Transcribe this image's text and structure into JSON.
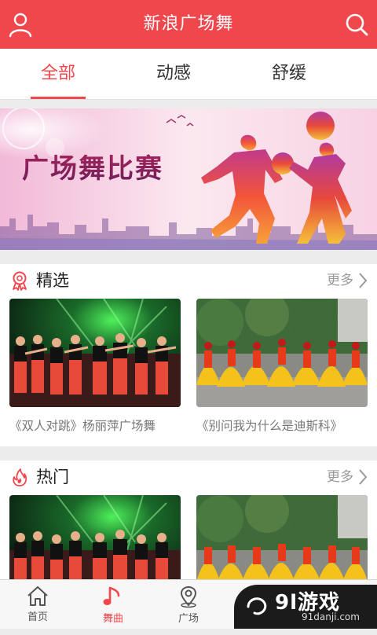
{
  "header": {
    "title": "新浪广场舞",
    "user_icon": "user-icon",
    "search_icon": "search-icon"
  },
  "tabs": [
    {
      "label": "全部",
      "active": true
    },
    {
      "label": "动感",
      "active": false
    },
    {
      "label": "舒缓",
      "active": false
    }
  ],
  "banner": {
    "text": "广场舞比赛"
  },
  "sections": [
    {
      "title": "精选",
      "icon": "award-icon",
      "more_label": "更多",
      "items": [
        {
          "caption": "《双人对跳》杨丽萍广场舞"
        },
        {
          "caption": "《别问我为什么是迪斯科》"
        }
      ]
    },
    {
      "title": "热门",
      "icon": "flame-icon",
      "more_label": "更多",
      "items": [
        {
          "caption": ""
        },
        {
          "caption": ""
        }
      ]
    }
  ],
  "tabbar": {
    "items": [
      {
        "label": "首页",
        "icon": "home-icon",
        "active": false
      },
      {
        "label": "舞曲",
        "icon": "music-note-icon",
        "active": true
      },
      {
        "label": "广场",
        "icon": "location-icon",
        "active": false
      },
      {
        "label": "",
        "icon": "tab4-icon",
        "active": false
      }
    ]
  },
  "watermark": {
    "main": "9l游戏",
    "sub": "91danji.com"
  },
  "colors": {
    "accent": "#f0474d",
    "text": "#333333",
    "muted": "#999999"
  }
}
